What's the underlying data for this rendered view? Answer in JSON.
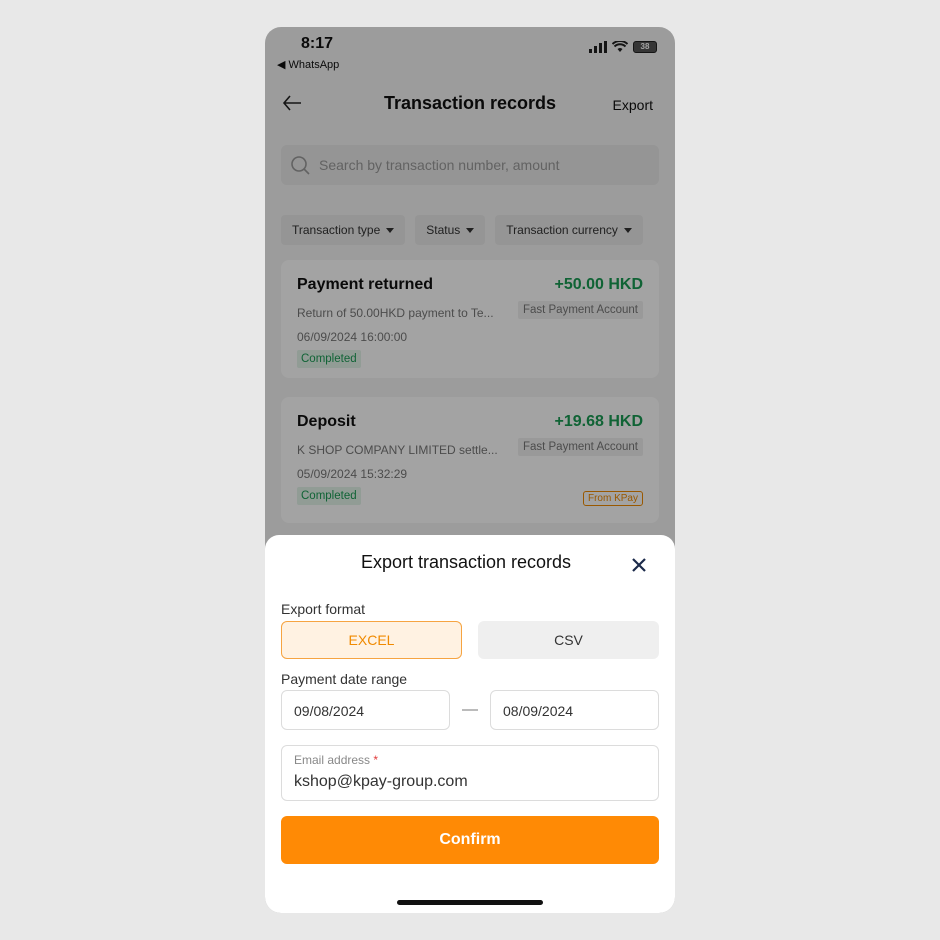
{
  "status_bar": {
    "time": "8:17",
    "back_app": "◀ WhatsApp",
    "battery": "38"
  },
  "nav": {
    "title": "Transaction records",
    "export_label": "Export",
    "back_icon": "arrow-left-icon"
  },
  "search": {
    "placeholder": "Search by transaction number, amount"
  },
  "filters": [
    {
      "label": "Transaction type"
    },
    {
      "label": "Status"
    },
    {
      "label": "Transaction currency"
    }
  ],
  "transactions": [
    {
      "title": "Payment returned",
      "amount": "+50.00 HKD",
      "description": "Return of  50.00HKD payment to Te...",
      "account": "Fast Payment Account",
      "datetime": "06/09/2024 16:00:00",
      "status": "Completed"
    },
    {
      "title": "Deposit",
      "amount": "+19.68 HKD",
      "description": "K SHOP COMPANY LIMITED settle...",
      "account": "Fast Payment Account",
      "datetime": "05/09/2024 15:32:29",
      "status": "Completed",
      "tag": "From KPay"
    }
  ],
  "export_sheet": {
    "title": "Export transaction records",
    "format_label": "Export format",
    "formats": [
      "EXCEL",
      "CSV"
    ],
    "selected_format": "EXCEL",
    "date_range_label": "Payment date range",
    "date_from": "09/08/2024",
    "date_to": "08/09/2024",
    "email_label": "Email address",
    "email_required_mark": "*",
    "email_value": "kshop@kpay-group.com",
    "confirm_label": "Confirm"
  },
  "colors": {
    "accent": "#ff8a05",
    "positive": "#1a9b54"
  }
}
